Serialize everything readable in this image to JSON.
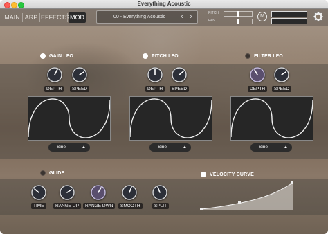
{
  "window": {
    "title": "Everything Acoustic"
  },
  "nav": {
    "tabs": [
      {
        "label": "MAIN",
        "active": false
      },
      {
        "label": "ARP",
        "active": false
      },
      {
        "label": "EFFECTS",
        "active": false
      },
      {
        "label": "MOD",
        "active": true
      }
    ]
  },
  "preset": {
    "name": "00 - Everything Acoustic"
  },
  "top_controls": {
    "pitch_label": "PITCH",
    "pan_label": "PAN",
    "monitor_button": "M"
  },
  "gain_lfo": {
    "title": "GAIN LFO",
    "enabled": true,
    "depth_label": "DEPTH",
    "speed_label": "SPEED",
    "shape": "Sine"
  },
  "pitch_lfo": {
    "title": "PITCH LFO",
    "enabled": true,
    "depth_label": "DEPTH",
    "speed_label": "SPEED",
    "shape": "Sine"
  },
  "filter_lfo": {
    "title": "FILTER LFO",
    "enabled": false,
    "depth_label": "DEPTH",
    "speed_label": "SPEED",
    "shape": "Sine"
  },
  "glide": {
    "title": "GLIDE",
    "enabled": false,
    "knobs": [
      "TIME",
      "RANGE UP",
      "RANGE DWN",
      "SMOOTH",
      "SPLIT"
    ]
  },
  "velocity": {
    "title": "VELOCITY CURVE",
    "enabled": true
  },
  "colors": {
    "accent_knob": "#9a8ab8",
    "panel_dark": "#262626",
    "knob_body": "#2c2f38"
  },
  "icons": {
    "settings": "gear-icon",
    "select_arrows": "updown-chevron-icon",
    "prev": "chevron-left-icon",
    "next": "chevron-right-icon"
  }
}
